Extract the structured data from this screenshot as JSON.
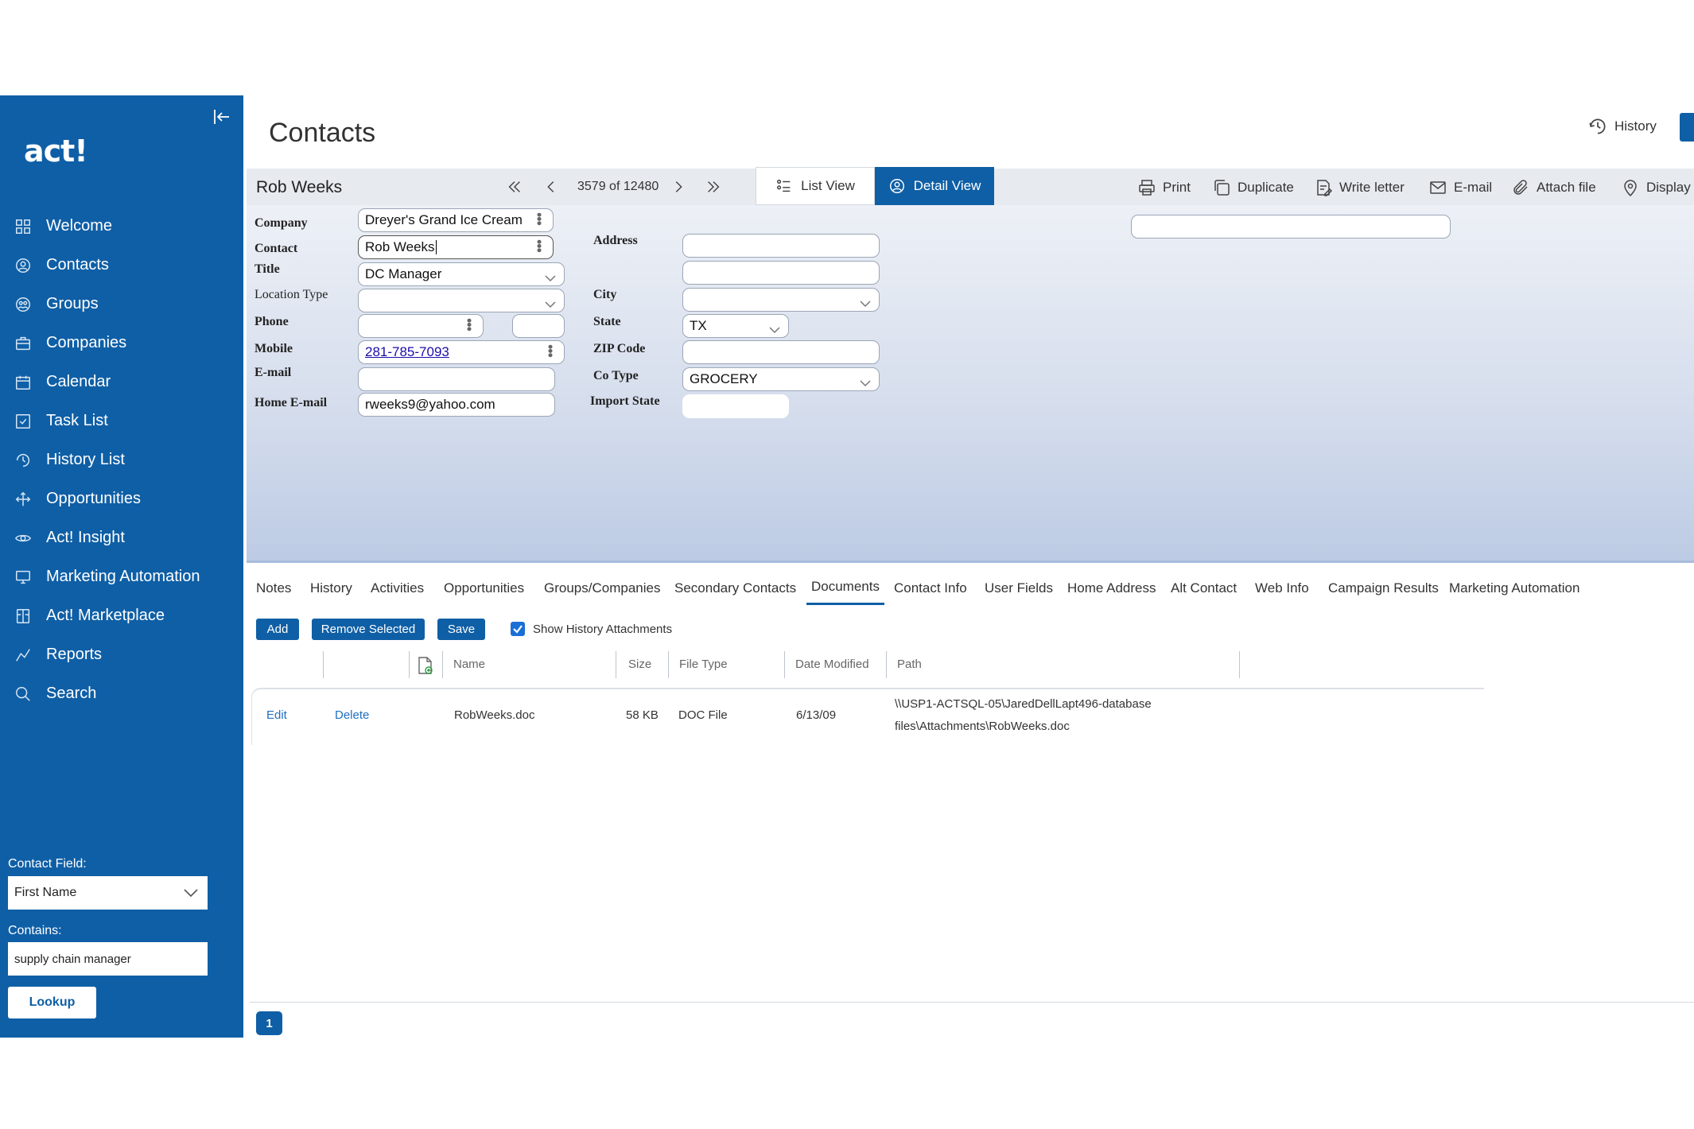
{
  "app": {
    "logo": "act!"
  },
  "sidebar": {
    "items": [
      {
        "label": "Welcome",
        "icon": "grid-icon"
      },
      {
        "label": "Contacts",
        "icon": "contact-icon"
      },
      {
        "label": "Groups",
        "icon": "groups-icon"
      },
      {
        "label": "Companies",
        "icon": "briefcase-icon"
      },
      {
        "label": "Calendar",
        "icon": "calendar-icon"
      },
      {
        "label": "Task List",
        "icon": "checkbox-icon"
      },
      {
        "label": "History List",
        "icon": "history-icon"
      },
      {
        "label": "Opportunities",
        "icon": "arrows-icon"
      },
      {
        "label": "Act! Insight",
        "icon": "eye-icon"
      },
      {
        "label": "Marketing Automation",
        "icon": "monitor-icon"
      },
      {
        "label": "Act! Marketplace",
        "icon": "marketplace-icon"
      },
      {
        "label": "Reports",
        "icon": "reports-icon"
      },
      {
        "label": "Search",
        "icon": "search-icon"
      }
    ],
    "lookup": {
      "field_label": "Contact Field:",
      "field_value": "First Name",
      "contains_label": "Contains:",
      "contains_value": "supply chain manager",
      "button": "Lookup"
    }
  },
  "header": {
    "title": "Contacts",
    "history": "History"
  },
  "record": {
    "name": "Rob Weeks",
    "count": "3579 of 12480",
    "list_view": "List View",
    "detail_view": "Detail View",
    "tools": [
      "Print",
      "Duplicate",
      "Write letter",
      "E-mail",
      "Attach file",
      "Display m"
    ]
  },
  "fields": {
    "company": {
      "label": "Company",
      "value": "Dreyer's Grand Ice Cream"
    },
    "contact": {
      "label": "Contact",
      "value": "Rob Weeks"
    },
    "title": {
      "label": "Title",
      "value": "DC Manager"
    },
    "location_type": {
      "label": "Location Type",
      "value": ""
    },
    "phone": {
      "label": "Phone",
      "value": ""
    },
    "mobile": {
      "label": "Mobile",
      "value": "281-785-7093"
    },
    "email": {
      "label": "E-mail",
      "value": ""
    },
    "home_email": {
      "label": "Home E-mail",
      "value": "rweeks9@yahoo.com"
    },
    "address": {
      "label": "Address",
      "value": ""
    },
    "city": {
      "label": "City",
      "value": ""
    },
    "state": {
      "label": "State",
      "value": "TX"
    },
    "zip": {
      "label": "ZIP Code",
      "value": ""
    },
    "co_type": {
      "label": "Co Type",
      "value": "GROCERY"
    },
    "import_state": {
      "label": "Import State",
      "value": ""
    }
  },
  "tabs": [
    "Notes",
    "History",
    "Activities",
    "Opportunities",
    "Groups/Companies",
    "Secondary Contacts",
    "Documents",
    "Contact Info",
    "User Fields",
    "Home Address",
    "Alt Contact",
    "Web Info",
    "Campaign Results",
    "Marketing Automation"
  ],
  "active_tab": "Documents",
  "documents": {
    "toolbar": {
      "add": "Add",
      "remove": "Remove Selected",
      "save": "Save",
      "show_history": "Show History Attachments"
    },
    "columns": [
      "Name",
      "Size",
      "File Type",
      "Date Modified",
      "Path"
    ],
    "rows": [
      {
        "edit": "Edit",
        "delete": "Delete",
        "name": "RobWeeks.doc",
        "size": "58 KB",
        "type": "DOC File",
        "date": "6/13/09",
        "path_1": "\\\\USP1-ACTSQL-05\\JaredDellLapt496-database",
        "path_2": "files\\Attachments\\RobWeeks.doc"
      }
    ]
  },
  "pager": {
    "page": "1"
  }
}
